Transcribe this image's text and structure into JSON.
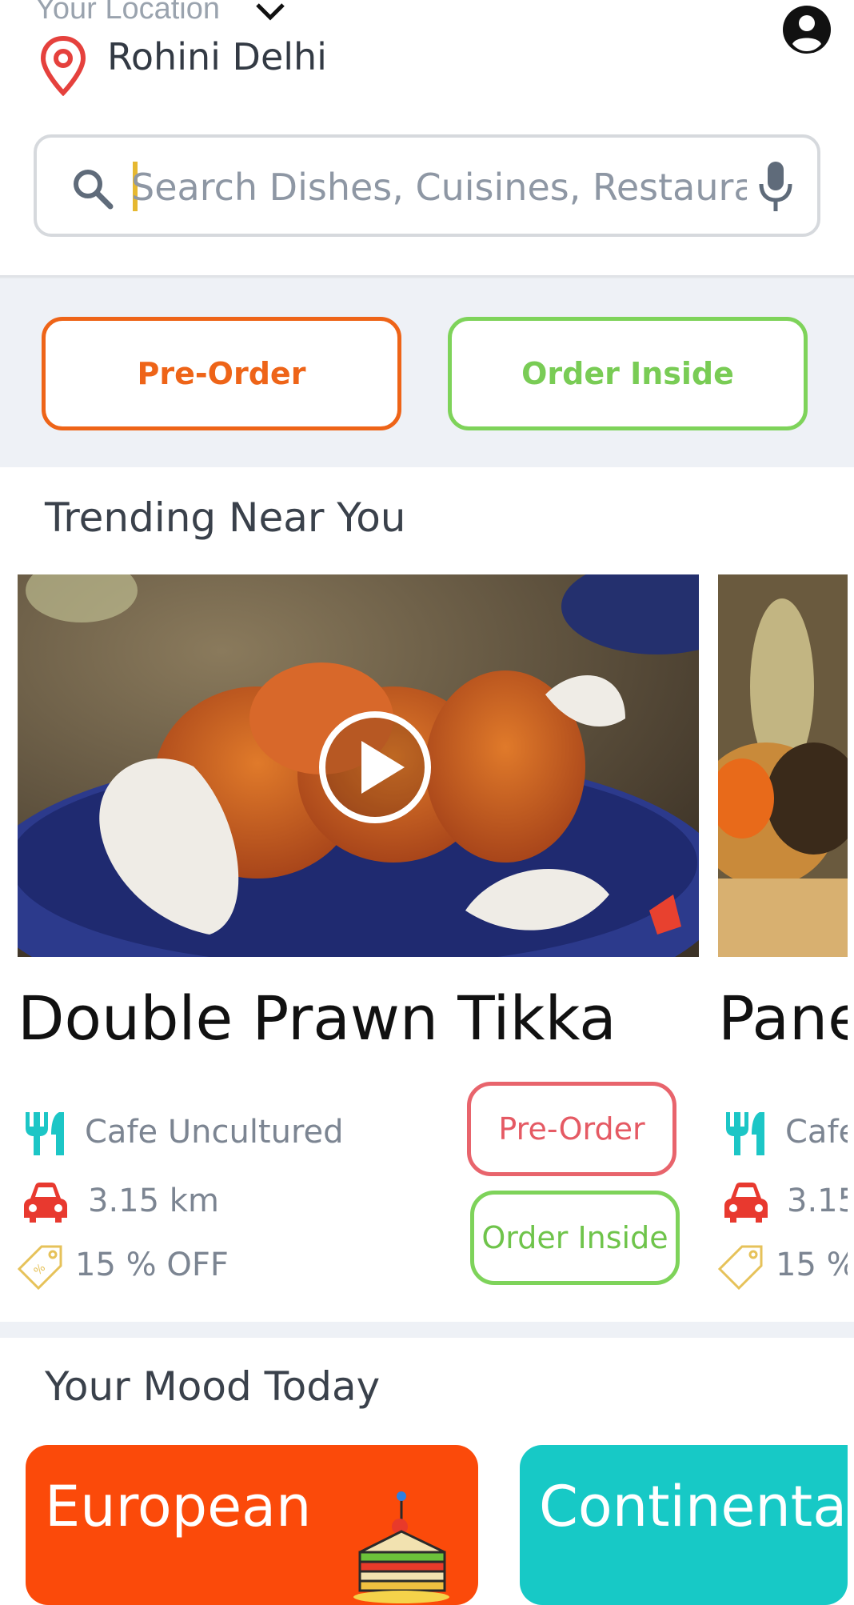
{
  "header": {
    "location_label": "Your Location",
    "city": "Rohini Delhi"
  },
  "search": {
    "placeholder": "Search Dishes, Cuisines, Restaurant"
  },
  "order_options": {
    "pre_order": "Pre-Order",
    "order_inside": "Order Inside"
  },
  "trending": {
    "title": "Trending Near You",
    "cards": [
      {
        "dish": "Double Prawn Tikka",
        "restaurant": "Cafe Uncultured",
        "distance": "3.15 km",
        "offer": "15 % OFF",
        "pre_order": "Pre-Order",
        "order_inside": "Order Inside"
      },
      {
        "dish": "Pane",
        "restaurant": "Cafe",
        "distance": "3.15",
        "offer": "15 %"
      }
    ]
  },
  "mood": {
    "title": "Your Mood Today",
    "items": [
      "European",
      "Continental"
    ]
  },
  "colors": {
    "accent_orange": "#ee6418",
    "accent_green": "#7ed35a",
    "pin_red": "#e5413d",
    "teal_icon": "#1cc6c6",
    "mood_orange": "#fb4a0a",
    "mood_teal": "#17c9c6"
  },
  "icons": [
    "chevron-down-icon",
    "location-pin-icon",
    "account-icon",
    "search-icon",
    "mic-icon",
    "play-icon",
    "fork-knife-icon",
    "car-icon",
    "tag-icon"
  ]
}
